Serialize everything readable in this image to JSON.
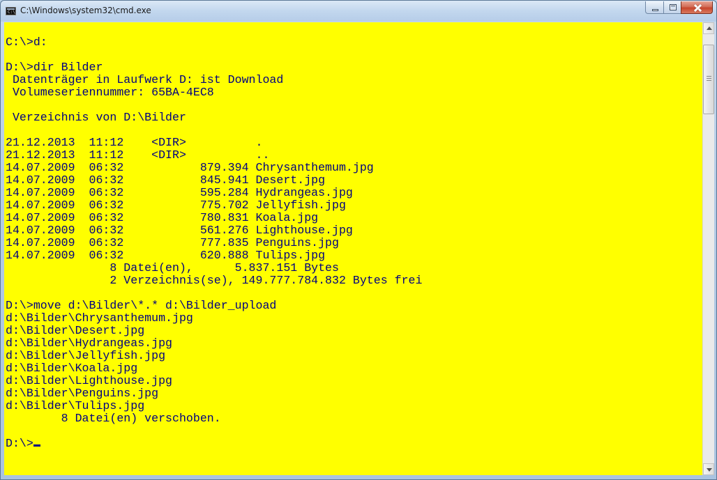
{
  "window": {
    "title": "C:\\Windows\\system32\\cmd.exe",
    "icon": "cmd-icon",
    "controls": [
      "minimize",
      "maximize",
      "close"
    ]
  },
  "console": {
    "background": "#ffff00",
    "foreground": "#000080",
    "lines": [
      "",
      "C:\\>d:",
      "",
      "D:\\>dir Bilder",
      " Datenträger in Laufwerk D: ist Download",
      " Volumeseriennummer: 65BA-4EC8",
      "",
      " Verzeichnis von D:\\Bilder",
      "",
      "21.12.2013  11:12    <DIR>          .",
      "21.12.2013  11:12    <DIR>          ..",
      "14.07.2009  06:32           879.394 Chrysanthemum.jpg",
      "14.07.2009  06:32           845.941 Desert.jpg",
      "14.07.2009  06:32           595.284 Hydrangeas.jpg",
      "14.07.2009  06:32           775.702 Jellyfish.jpg",
      "14.07.2009  06:32           780.831 Koala.jpg",
      "14.07.2009  06:32           561.276 Lighthouse.jpg",
      "14.07.2009  06:32           777.835 Penguins.jpg",
      "14.07.2009  06:32           620.888 Tulips.jpg",
      "               8 Datei(en),      5.837.151 Bytes",
      "               2 Verzeichnis(se), 149.777.784.832 Bytes frei",
      "",
      "D:\\>move d:\\Bilder\\*.* d:\\Bilder_upload",
      "d:\\Bilder\\Chrysanthemum.jpg",
      "d:\\Bilder\\Desert.jpg",
      "d:\\Bilder\\Hydrangeas.jpg",
      "d:\\Bilder\\Jellyfish.jpg",
      "d:\\Bilder\\Koala.jpg",
      "d:\\Bilder\\Lighthouse.jpg",
      "d:\\Bilder\\Penguins.jpg",
      "d:\\Bilder\\Tulips.jpg",
      "        8 Datei(en) verschoben.",
      ""
    ],
    "prompt": "D:\\>"
  }
}
